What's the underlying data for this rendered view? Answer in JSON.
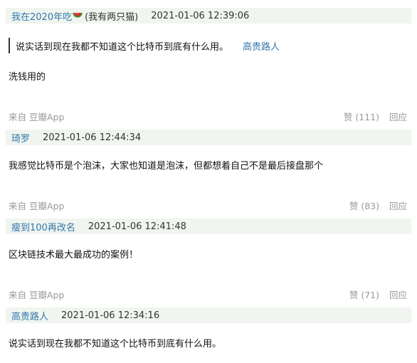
{
  "comments": [
    {
      "author": "我在2020年吃",
      "note": "(我有两只猫)",
      "time": "2021-01-06 12:39:06",
      "quote": {
        "text": "说实话到现在我都不知道这个比特币到底有什么用。",
        "author": "高贵路人"
      },
      "text": "洗钱用的",
      "source": "来自 豆瓣App",
      "like": "赞 (111)",
      "reply": "回应"
    },
    {
      "author": "琦罗",
      "time": "2021-01-06 12:44:34",
      "text": "我感觉比特币是个泡沫，大家也知道是泡沫，但都想着自己不是最后接盘那个",
      "source": "来自 豆瓣App",
      "like": "赞 (83)",
      "reply": "回应"
    },
    {
      "author": "瘦到100再改名",
      "time": "2021-01-06 12:41:48",
      "text": "区块链技术最大最成功的案例！",
      "source": "来自 豆瓣App",
      "like": "赞 (71)",
      "reply": "回应"
    },
    {
      "author": "高贵路人",
      "time": "2021-01-06 12:34:16",
      "text": "说实话到现在我都不知道这个比特币到底有什么用。"
    }
  ],
  "icons": {
    "watermelon": "watermelon-emoji"
  },
  "colors": {
    "author": "#3377aa",
    "header_bg": "#f0f5f0",
    "meta": "#999999"
  }
}
